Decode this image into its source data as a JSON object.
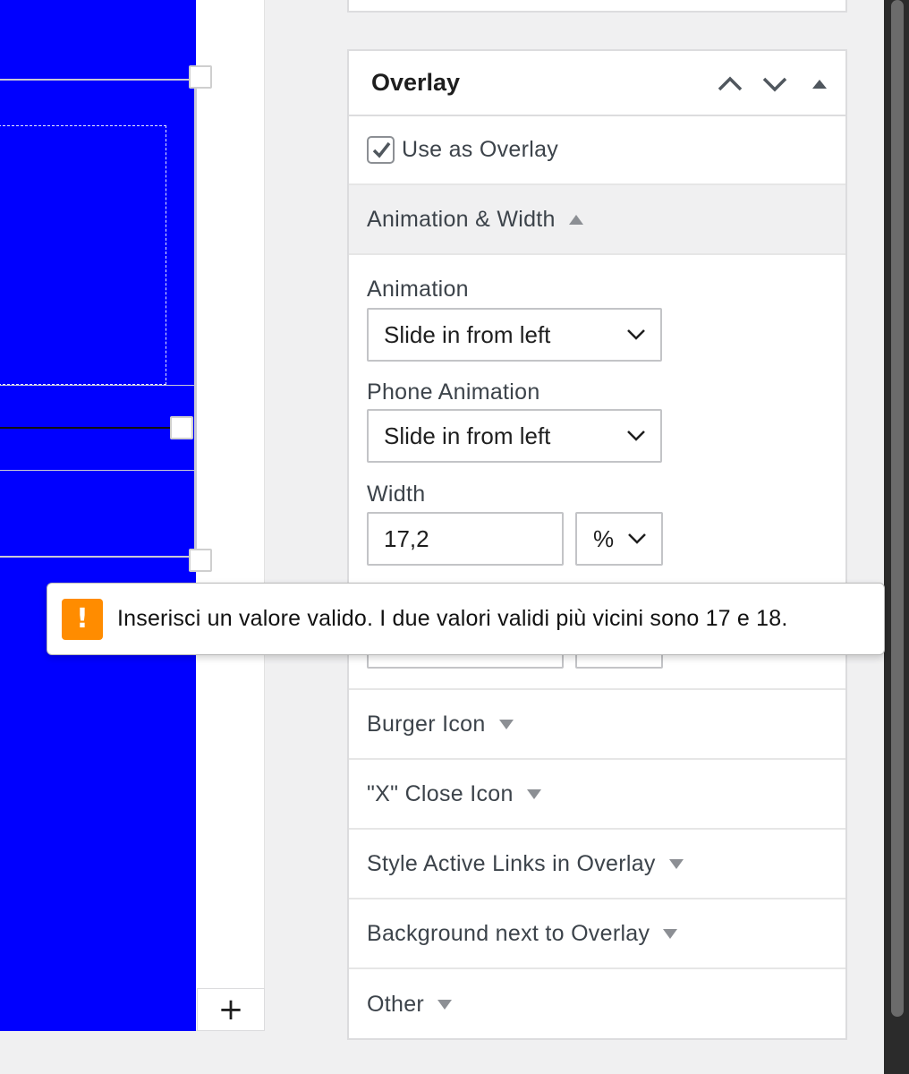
{
  "panel": {
    "title": "Overlay",
    "use_overlay_label": "Use as Overlay",
    "use_overlay_checked": true
  },
  "animation_section": {
    "title": "Animation & Width",
    "animation_label": "Animation",
    "animation_value": "Slide in from left",
    "phone_animation_label": "Phone Animation",
    "phone_animation_value": "Slide in from left",
    "width_label": "Width",
    "width_value": "17,2",
    "width_unit": "%"
  },
  "validation_tooltip": {
    "icon": "!",
    "message": "Inserisci un valore valido. I due valori validi più vicini sono 17 e 18."
  },
  "sections": [
    {
      "title": "Burger Icon"
    },
    {
      "title": "\"X\" Close Icon"
    },
    {
      "title": "Style Active Links in Overlay"
    },
    {
      "title": "Background next to Overlay"
    },
    {
      "title": "Other"
    }
  ],
  "canvas": {
    "add_block_label": "+",
    "block_color": "#0000ff"
  }
}
